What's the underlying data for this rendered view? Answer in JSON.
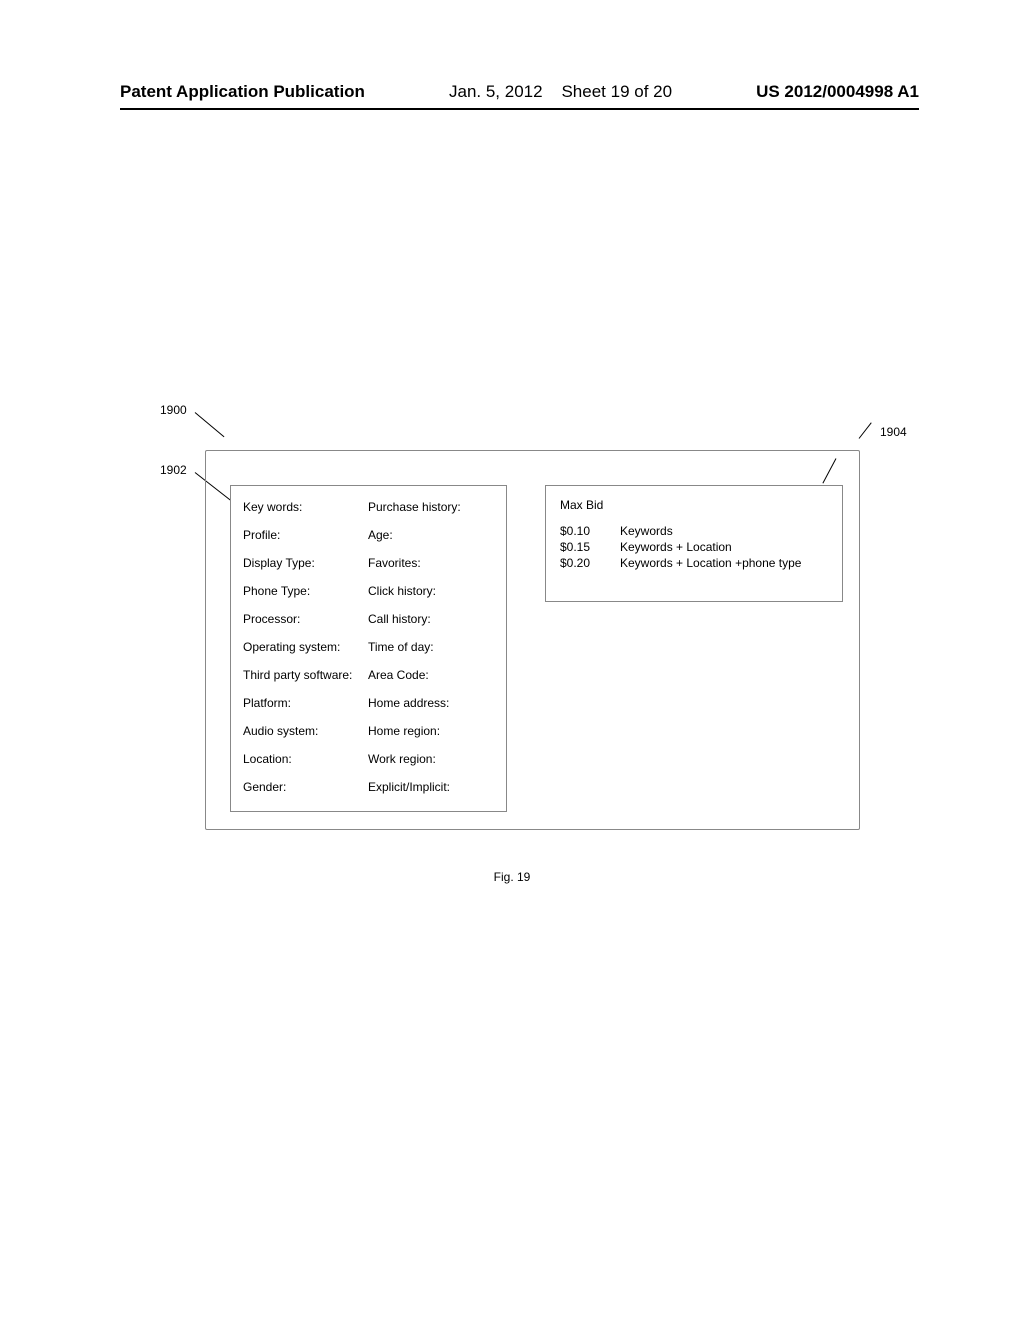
{
  "header": {
    "publication": "Patent Application Publication",
    "date": "Jan. 5, 2012",
    "sheet": "Sheet 19 of 20",
    "docnum": "US 2012/0004998 A1"
  },
  "callouts": {
    "c1900": "1900",
    "c1902": "1902",
    "c1904": "1904"
  },
  "left_panel": {
    "col1": [
      "Key words:",
      "Profile:",
      "Display Type:",
      "Phone Type:",
      "Processor:",
      "Operating system:",
      "Third party software:",
      "Platform:",
      "Audio system:",
      "Location:",
      "Gender:"
    ],
    "col2": [
      "Purchase history:",
      "Age:",
      "Favorites:",
      "Click history:",
      "Call history:",
      "Time of day:",
      "Area Code:",
      "Home address:",
      "Home region:",
      "Work region:",
      "Explicit/Implicit:"
    ]
  },
  "right_panel": {
    "title": "Max Bid",
    "rows": [
      {
        "amount": "$0.10",
        "desc": "Keywords"
      },
      {
        "amount": "$0.15",
        "desc": "Keywords + Location"
      },
      {
        "amount": "$0.20",
        "desc": "Keywords + Location +phone type"
      }
    ]
  },
  "figure_caption": "Fig. 19"
}
